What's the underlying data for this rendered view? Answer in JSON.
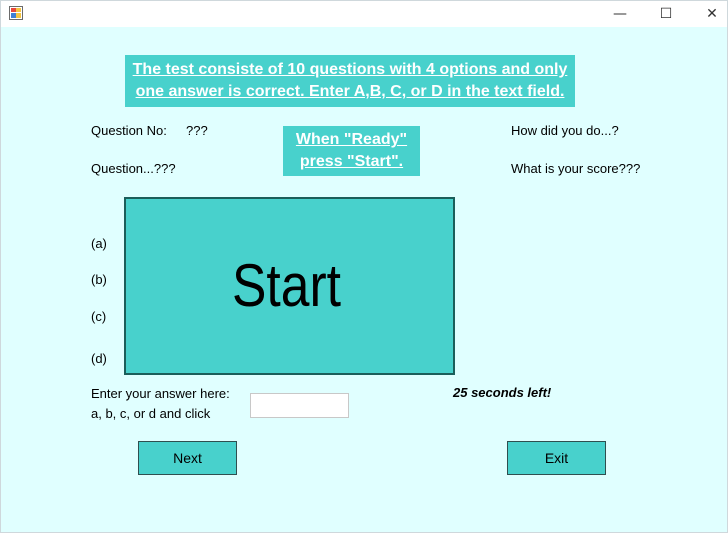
{
  "window": {
    "minimize_glyph": "—",
    "maximize_glyph": "☐",
    "close_glyph": "✕"
  },
  "instructions": {
    "line1": "The test consiste of 10 questions with 4 options and only",
    "line2": "one answer is correct. Enter A,B, C, or D in the text field."
  },
  "ready_banner": {
    "line1": "When \"Ready\"",
    "line2": "press \"Start\"."
  },
  "question": {
    "number_label": "Question No:",
    "number_value": "???",
    "text": "Question...???"
  },
  "status": {
    "how_did_you_do": "How did you do...?",
    "score": "What is your score???"
  },
  "options": {
    "a": "(a)",
    "b": "(b)",
    "c": "(c)",
    "d": "(d)"
  },
  "start_panel": {
    "label": "Start"
  },
  "answer": {
    "prompt_line1": "Enter your answer here:",
    "prompt_line2": "a, b, c, or d and click",
    "value": ""
  },
  "timer": {
    "text": "25 seconds left!"
  },
  "buttons": {
    "next": "Next",
    "exit": "Exit"
  },
  "colors": {
    "background": "#e0ffff",
    "accent": "#48d1cc",
    "banner_text": "#ffffff"
  },
  "icons": {
    "app": "app-form-icon"
  }
}
